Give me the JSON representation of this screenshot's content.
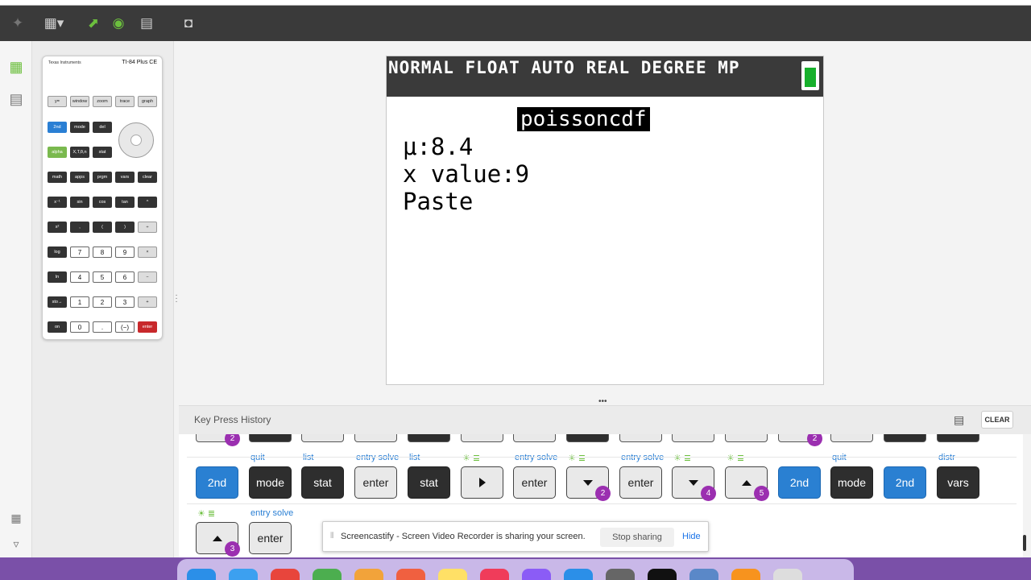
{
  "toolbar": {
    "icons": [
      "ti-logo-icon",
      "calculator-menu-icon",
      "send-icon",
      "battery-5-icon",
      "layout-icon",
      "camera-icon"
    ]
  },
  "calculator_thumb": {
    "brand": "Texas Instruments",
    "model": "TI-84 Plus CE"
  },
  "screen": {
    "status_text": "NORMAL FLOAT AUTO REAL DEGREE MP",
    "menu_title": "poissoncdf",
    "lines": [
      "μ:8.4",
      "x value:9",
      "Paste"
    ],
    "battery_level": 1.0
  },
  "history": {
    "title": "Key Press History",
    "clear_label": "CLEAR",
    "row1": [
      {
        "sec": "",
        "label": "2nd",
        "style": "b"
      },
      {
        "sec": "quit",
        "label": "mode",
        "style": "dk"
      },
      {
        "sec": "list",
        "label": "stat",
        "style": "dk"
      },
      {
        "sec": "entry solve",
        "label": "enter",
        "style": "l"
      },
      {
        "sec": "list",
        "label": "stat",
        "style": "dk"
      },
      {
        "sec": "",
        "label": "",
        "style": "l",
        "icon": "right-arrow-icon"
      },
      {
        "sec": "entry solve",
        "label": "enter",
        "style": "l"
      },
      {
        "sec": "",
        "label": "",
        "style": "l",
        "icon": "down-arrow-icon",
        "badge": "2"
      },
      {
        "sec": "entry solve",
        "label": "enter",
        "style": "l"
      },
      {
        "sec": "",
        "label": "",
        "style": "l",
        "icon": "down-arrow-icon",
        "badge": "4"
      },
      {
        "sec": "",
        "label": "",
        "style": "l",
        "icon": "up-arrow-icon",
        "badge": "5"
      },
      {
        "sec": "",
        "label": "2nd",
        "style": "b"
      },
      {
        "sec": "quit",
        "label": "mode",
        "style": "dk"
      },
      {
        "sec": "",
        "label": "2nd",
        "style": "b"
      },
      {
        "sec": "distr",
        "label": "vars",
        "style": "dk"
      }
    ],
    "row2": [
      {
        "sec": "",
        "label": "",
        "style": "l",
        "icon": "up-arrow-icon",
        "badge": "3"
      },
      {
        "sec": "entry solve",
        "label": "enter",
        "style": "l"
      }
    ],
    "stub_badges": [
      "2",
      "2"
    ]
  },
  "share": {
    "message": "Screencastify - Screen Video Recorder is sharing your screen.",
    "stop_label": "Stop sharing",
    "hide_label": "Hide"
  },
  "colors": {
    "accent_blue": "#2a80d2",
    "badge_purple": "#9b2fb0",
    "battery_green": "#17b02c",
    "toolbar_dark": "#3a3a3a"
  }
}
